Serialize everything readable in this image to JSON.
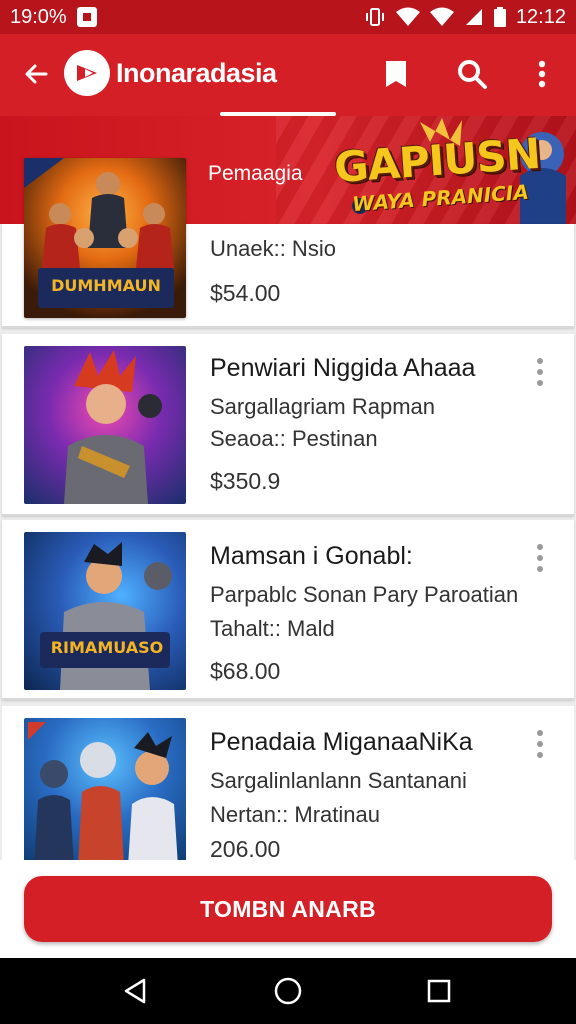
{
  "status_bar": {
    "time_left": "19:0%",
    "time_right": "12:12"
  },
  "app_bar": {
    "title": "Inonaradasia",
    "icons": [
      "back-arrow-icon",
      "app-logo-icon",
      "bookmark-icon",
      "search-icon",
      "more-vert-icon"
    ]
  },
  "banner": {
    "text": "Pemaagia",
    "brand_title": "GAPIUSN",
    "brand_subtitle": "WAYA PRANICIA"
  },
  "items": [
    {
      "title": "",
      "line1": "Unaek:: Nsio",
      "line2": "",
      "price": "$54.00",
      "thumb_caption": "DUMHMAUN",
      "colors": [
        "#3a1a08",
        "#e36a12",
        "#1b2f6b"
      ]
    },
    {
      "title": "Penwiari Niggida Ahaaa",
      "line1": "Sargallagriam Rapman",
      "line2": "Seaoa:: Pestinan",
      "price": "$350.9",
      "thumb_caption": "",
      "colors": [
        "#2a1050",
        "#b23a9a",
        "#1a2f6a"
      ]
    },
    {
      "title": "Mamsan i Gonabl:",
      "line1": "Parpablc Sonan Pary Paroatian",
      "line2": "Tahalt:: Mald",
      "price": "$68.00",
      "thumb_caption": "RIMAMUASO",
      "colors": [
        "#0c2650",
        "#2a6cc4",
        "#f0a020"
      ]
    },
    {
      "title": "Penadaia MiganaaNiKa",
      "line1": "Sargalinlanlann Santanani",
      "line2": "Nertan:: Mratinau",
      "price": "206.00",
      "thumb_caption": "",
      "colors": [
        "#0d3a70",
        "#3f8fd0",
        "#d23a2a"
      ]
    }
  ],
  "cta": {
    "label": "TOMBN ANARB"
  },
  "colors": {
    "primary": "#d41f26",
    "status_bar": "#b7141c",
    "background": "#ececec"
  }
}
